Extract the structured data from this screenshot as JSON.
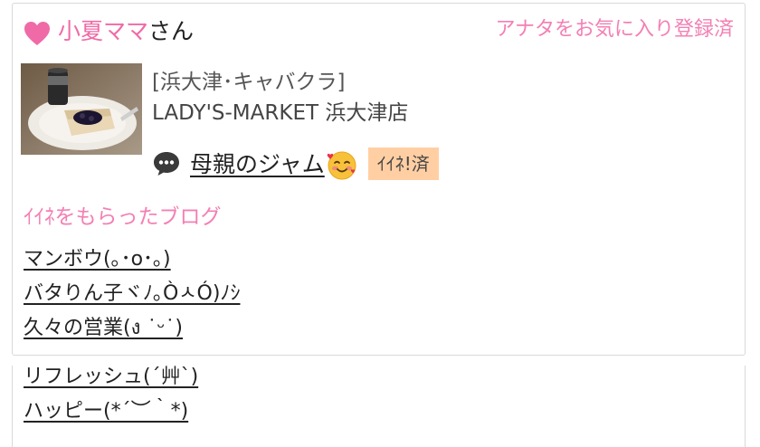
{
  "profile": {
    "name": "小夏ママ",
    "honorific": "さん",
    "favorite_status": "アナタをお気に入り登録済",
    "heart_icon": "heart-icon",
    "heart_color": "#f06aa7"
  },
  "shop": {
    "category": "[浜大津･キャバクラ]",
    "name": "LADY'S-MARKET 浜大津店"
  },
  "blog": {
    "title": "母親のジャム",
    "icon": "chat-bubble-icon",
    "emoji": "smiling-face-with-hearts",
    "iine_badge": "ｲｲﾈ!済",
    "badge_color": "#ffcfa3"
  },
  "liked_blogs": {
    "heading": "ｲｲﾈをもらったブログ",
    "items": [
      "マンボウ(｡･o･｡)",
      "バタりん子ヾﾉ｡ÒㅅÓ)ﾉｼ",
      "久々の営業(ง ˙ᵕ˙)",
      "リフレッシュ(´艸`)",
      "ハッピー(*´︶｀*)"
    ]
  },
  "accent_color": "#f47fb4"
}
